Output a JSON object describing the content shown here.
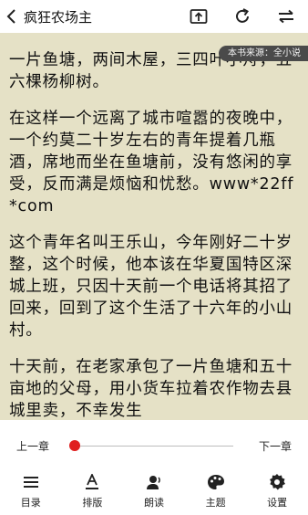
{
  "header": {
    "title": "疯狂农场主",
    "icons": [
      "back-icon",
      "share-icon",
      "refresh-icon",
      "switch-icon"
    ]
  },
  "source_tag": "本书来源：全小说",
  "paragraphs": [
    "一片鱼塘，两间木屋，三四叶小舟，五六棵杨柳树。",
    "在这样一个远离了城市喧嚣的夜晚中，一个约莫二十岁左右的青年提着几瓶酒，席地而坐在鱼塘前，没有悠闲的享受，反而满是烦恼和忧愁。www*22ff*com",
    "这个青年名叫王乐山，今年刚好二十岁整，这个时候，他本该在华夏国特区深城上班，只因十天前一个电话将其招了回来，回到了这个生活了十六年的小山村。",
    "十天前，在老家承包了一片鱼塘和五十亩地的父母，用小货车拉着农作物去县城里卖，不幸发生"
  ],
  "progress": {
    "prev_label": "上一章",
    "next_label": "下一章",
    "value": 0
  },
  "menu": [
    {
      "label": "目录",
      "icon": "catalog-icon"
    },
    {
      "label": "排版",
      "icon": "typesetting-icon"
    },
    {
      "label": "朗读",
      "icon": "read-aloud-icon"
    },
    {
      "label": "主题",
      "icon": "theme-icon"
    },
    {
      "label": "设置",
      "icon": "settings-icon"
    }
  ]
}
